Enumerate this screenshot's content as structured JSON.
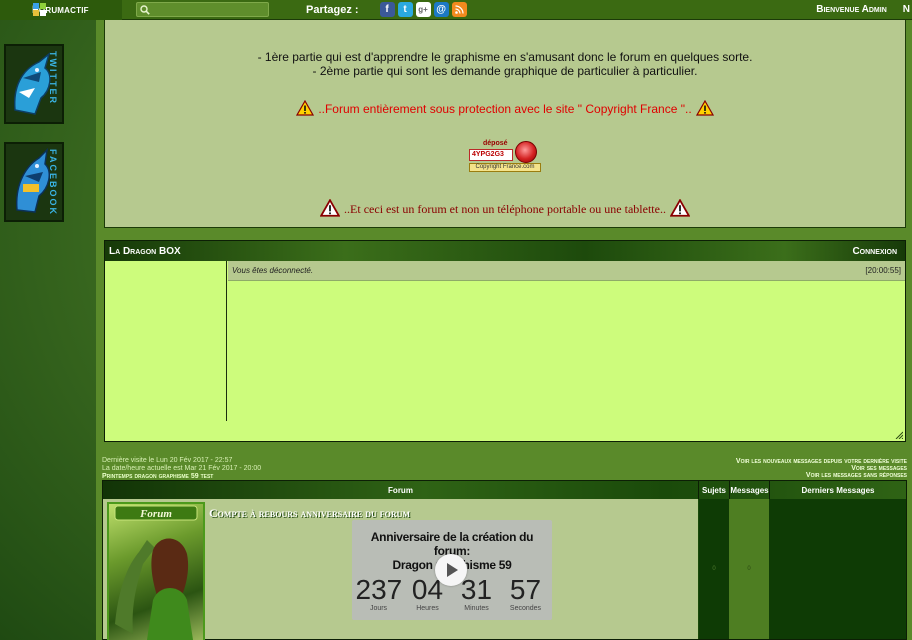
{
  "colors": {
    "topbar": "#3b6a12",
    "panel": "#b6c98f",
    "chatbox": "#cdfc7c",
    "warning_red": "#e00000",
    "dark_red": "#8a0000",
    "twitter_blue": "#3ab4e6"
  },
  "topbar": {
    "brand": "Forumactif",
    "search_placeholder": "",
    "share_label": "Partagez :",
    "share_icons": [
      "facebook-icon",
      "twitter-icon",
      "google-plus-icon",
      "email-icon",
      "rss-icon"
    ],
    "welcome": "Bienvenue Admin",
    "extra": "N"
  },
  "sidebar": {
    "twitter_label": "TWITTER",
    "facebook_label": "FACEBOOK"
  },
  "intro": {
    "line1": "- 1ère partie qui est d'apprendre le graphisme en s'amusant donc le forum en quelques sorte.",
    "line2": "- 2ème partie qui sont les demande graphique de particulier à particulier.",
    "warning": "..Forum entièrement sous protection avec le site \" Copyright France \"..",
    "depose_label": "déposé",
    "depose_code": "4YPG2G3",
    "depose_site": "Copyright France.com",
    "phone_warning": "..Et ceci est un forum et non un téléphone portable ou une tablette.."
  },
  "dragon_box": {
    "title": "La Dragon BOX",
    "connexion": "Connexion",
    "message": "Vous êtes déconnecté.",
    "time": "[20:00:55]"
  },
  "visit": {
    "last_visit": "Dernière visite le Lun 20 Fév 2017 - 22:57",
    "current": "La date/heure actuelle est Mar 21 Fév 2017 - 20:00",
    "category": "Printemps dragon graphisme 59 test"
  },
  "right_links": [
    "Voir les nouveaux messages depuis votre dernière visite",
    "Voir ses messages",
    "Voir les messages sans réponses"
  ],
  "forum_table": {
    "headers": {
      "forum": "Forum",
      "sujets": "Sujets",
      "messages": "Messages",
      "derniers": "Derniers Messages"
    },
    "row": {
      "image_caption": "Forum",
      "title": "Compte à rebours anniversaire du forum",
      "sujets": "0",
      "messages": "0"
    },
    "countdown": {
      "title_line1": "Anniversaire de la création du forum:",
      "title_line2": "Dragon Graphisme 59",
      "units": [
        {
          "value": "237",
          "label": "Jours"
        },
        {
          "value": "04",
          "label": "Heures"
        },
        {
          "value": "31",
          "label": "Minutes"
        },
        {
          "value": "57",
          "label": "Secondes"
        }
      ]
    }
  }
}
